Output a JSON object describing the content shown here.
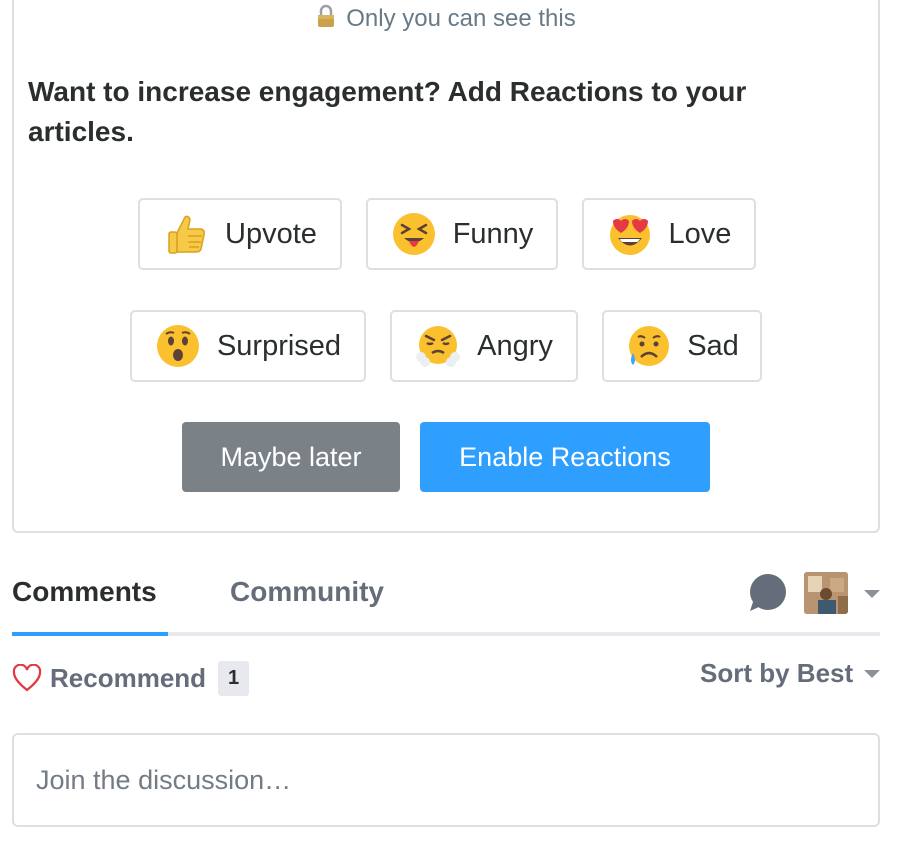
{
  "privacy_note": "Only you can see this",
  "headline": "Want to increase engagement? Add Reactions to your articles.",
  "reactions": [
    {
      "label": "Upvote",
      "icon": "thumbs-up-icon"
    },
    {
      "label": "Funny",
      "icon": "laughing-tongue-icon"
    },
    {
      "label": "Love",
      "icon": "heart-eyes-icon"
    },
    {
      "label": "Surprised",
      "icon": "surprised-face-icon"
    },
    {
      "label": "Angry",
      "icon": "angry-face-icon"
    },
    {
      "label": "Sad",
      "icon": "sad-tear-face-icon"
    }
  ],
  "actions": {
    "maybe_later": "Maybe later",
    "enable": "Enable Reactions"
  },
  "tabs": [
    {
      "label": "Comments",
      "active": true
    },
    {
      "label": "Community",
      "active": false
    }
  ],
  "recommend": {
    "label": "Recommend",
    "count": "1"
  },
  "sort": {
    "label": "Sort by Best"
  },
  "composer": {
    "placeholder": "Join the discussion…"
  },
  "colors": {
    "accent": "#2e9fff",
    "secondary_button": "#7a8288",
    "heart": "#e0393e"
  }
}
